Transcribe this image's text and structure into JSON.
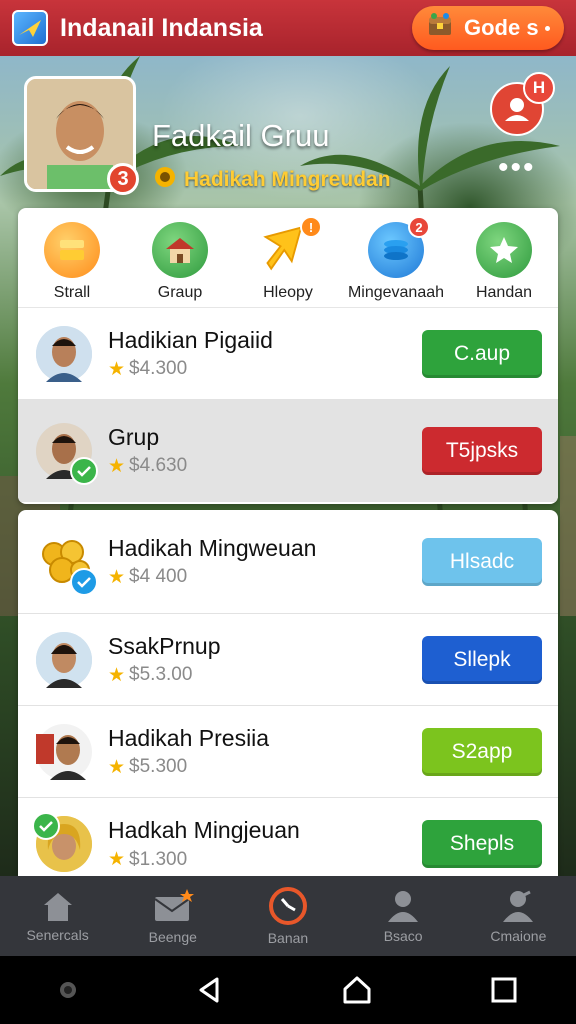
{
  "header": {
    "title": "Indanail Indansia",
    "coins_label": "Gode s"
  },
  "profile": {
    "name": "Fadkail Gruu",
    "subtitle": "Hadikah Mingreudan",
    "badge_count": "3",
    "notification_badge": "H"
  },
  "categories": [
    {
      "label": "Strall",
      "icon": "stack-icon",
      "color": "#ff8c1a"
    },
    {
      "label": "Graup",
      "icon": "house-icon",
      "color": "#3aa64a"
    },
    {
      "label": "Hleopy",
      "icon": "star-arrow-icon",
      "color": "#ffc21a",
      "badge": "!"
    },
    {
      "label": "Mingevanaah",
      "icon": "coins-icon",
      "color": "#1e8be6",
      "badge": "2"
    },
    {
      "label": "Handan",
      "icon": "star-icon",
      "color": "#3aa64a"
    }
  ],
  "rows": [
    {
      "name": "Hadikian Pigaiid",
      "price": "$4.300",
      "button": "C.aup",
      "button_color": "#2ea33c"
    },
    {
      "name": "Grup",
      "price": "$4.630",
      "button": "T5jpsks",
      "button_color": "#cc2a2f"
    },
    {
      "name": "Hadikah Mingweuan",
      "price": "$4 400",
      "button": "Hlsadc",
      "button_color": "#6ec3ec"
    },
    {
      "name": "SsakPrnup",
      "price": "$5.3.00",
      "button": "Sllepk",
      "button_color": "#1e5fd1"
    },
    {
      "name": "Hadikah Presiia",
      "price": "$5.300",
      "button": "S2app",
      "button_color": "#7cc41e"
    },
    {
      "name": "Hadkah Mingjeuan",
      "price": "$1.300",
      "button": "Shepls",
      "button_color": "#2ea33c"
    }
  ],
  "bottom_nav": [
    {
      "label": "Senercals",
      "icon": "home-icon"
    },
    {
      "label": "Beenge",
      "icon": "mail-icon"
    },
    {
      "label": "Banan",
      "icon": "clock-icon"
    },
    {
      "label": "Bsaco",
      "icon": "person-icon"
    },
    {
      "label": "Cmaione",
      "icon": "profile-icon"
    }
  ]
}
